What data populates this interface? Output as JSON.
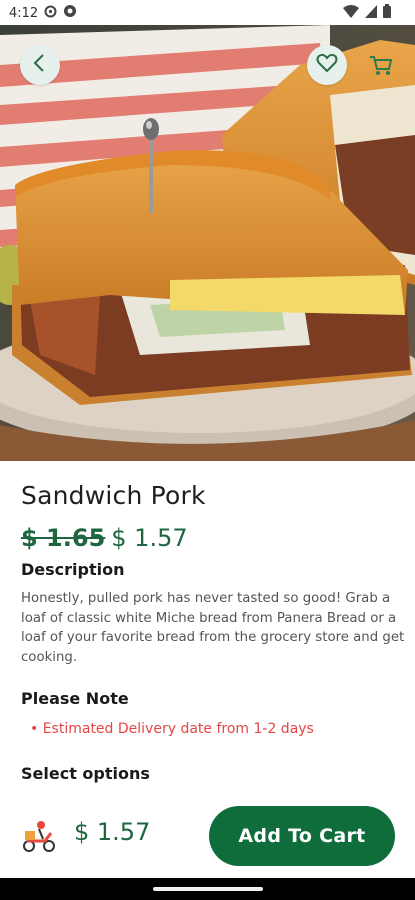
{
  "status_bar": {
    "time": "4:12",
    "icons": [
      "settings-icon",
      "at-sign-icon",
      "wifi-icon",
      "signal-icon",
      "battery-icon"
    ]
  },
  "header": {
    "back_icon": "chevron-left-icon",
    "favorite_icon": "heart-outline-icon",
    "cart_icon": "cart-icon"
  },
  "product": {
    "title": "Sandwich Pork",
    "old_price": "$ 1.65",
    "new_price": "$ 1.57",
    "description_title": "Description",
    "description": "Honestly, pulled pork has never tasted so good! Grab a loaf of classic white Miche bread from Panera Bread or a loaf of your favorite bread from the grocery store and get cooking.",
    "note_title": "Please Note",
    "note_items": [
      "• Estimated Delivery date from 1-2 days"
    ],
    "options_title": "Select options"
  },
  "bottom_bar": {
    "icon": "delivery-scooter-icon",
    "price": "$ 1.57",
    "add_to_cart_label": "Add To Cart"
  },
  "colors": {
    "brand_green": "#0f6d3c",
    "price_green": "#1d6640",
    "note_red": "#e64545",
    "icon_bubble": "#e6f0ec"
  }
}
